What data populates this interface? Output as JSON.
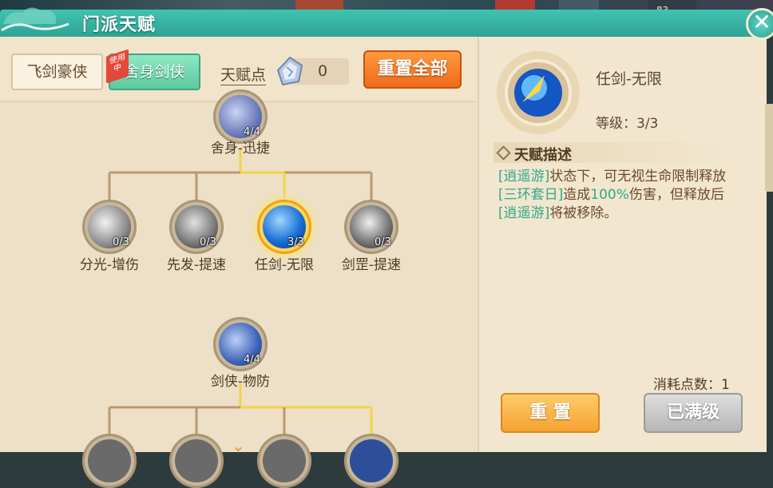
{
  "header": {
    "title": "门派天赋",
    "bg_number": "83"
  },
  "tabs": [
    {
      "label": "飞剑豪侠",
      "active": false
    },
    {
      "label": "舍身剑侠",
      "active": true,
      "badge": "使用中"
    }
  ],
  "talent_points": {
    "label": "天赋点",
    "value": "0"
  },
  "reset_all_label": "重置全部",
  "tree": {
    "top_node": {
      "name": "舍身-迅捷",
      "count": "4/4"
    },
    "row1": [
      {
        "name": "分光-增伤",
        "count": "0/3"
      },
      {
        "name": "先发-提速",
        "count": "0/3"
      },
      {
        "name": "任剑-无限",
        "count": "3/3"
      },
      {
        "name": "剑罡-提速",
        "count": "0/3"
      }
    ],
    "mid_node": {
      "name": "剑侠-物防",
      "count": "4/4"
    }
  },
  "detail": {
    "name": "任剑-无限",
    "level": "等级：3/3",
    "desc_title": "天赋描述",
    "desc_parts": [
      {
        "t": "[逍遥游]",
        "hl": true
      },
      {
        "t": "状态下，可无视生命限制释放",
        "hl": false
      },
      {
        "t": "[三环套日]",
        "hl": true
      },
      {
        "t": "造成",
        "hl": false
      },
      {
        "t": "100%",
        "hl": true
      },
      {
        "t": "伤害，但释放后",
        "hl": false
      },
      {
        "t": "[逍遥游]",
        "hl": true
      },
      {
        "t": "将被移除。",
        "hl": false
      }
    ],
    "cost": "消耗点数：1",
    "reset_label": "重 置",
    "maxed_label": "已满级"
  },
  "colors": {
    "accent_teal": "#3bb5a4",
    "highlight": "#2fa88a",
    "gold_line": "#f2d24a",
    "brown_line": "#b89a70"
  },
  "icons": {
    "close": "close-icon",
    "gem": "talent-gem-icon",
    "expand": "chevron-down-icon"
  }
}
